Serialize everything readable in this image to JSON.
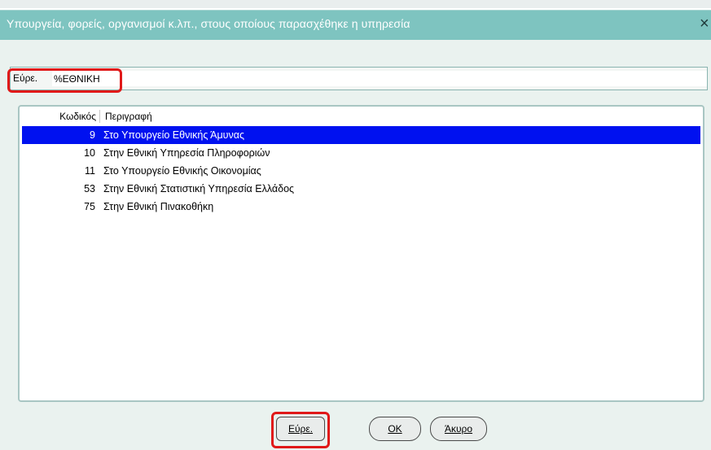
{
  "window": {
    "title": "Υπουργεία, φορείς, οργανισμοί κ.λπ., στους οποίους παρασχέθηκε η υπηρεσία",
    "close_glyph": "×"
  },
  "find": {
    "label": "Εύρε.",
    "value": "%ΕΘΝΙΚΗ"
  },
  "list": {
    "columns": [
      "Κωδικός",
      "Περιγραφή"
    ],
    "rows": [
      {
        "code": "9",
        "description": "Στο Υπουργείο Εθνικής Άμυνας",
        "selected": true
      },
      {
        "code": "10",
        "description": "Στην Εθνική Υπηρεσία Πληροφοριών",
        "selected": false
      },
      {
        "code": "11",
        "description": "Στο Υπουργείο Εθνικής Οικονομίας",
        "selected": false
      },
      {
        "code": "53",
        "description": "Στην Εθνική Στατιστική Υπηρεσία Ελλάδος",
        "selected": false
      },
      {
        "code": "75",
        "description": "Στην Εθνική Πινακοθήκη",
        "selected": false
      }
    ]
  },
  "buttons": {
    "find": "Εύρε.",
    "ok": "OK",
    "cancel": "Άκυρο"
  },
  "colors": {
    "titlebar": "#7ec4c0",
    "selection": "#0011f0",
    "highlight": "#e01919"
  }
}
